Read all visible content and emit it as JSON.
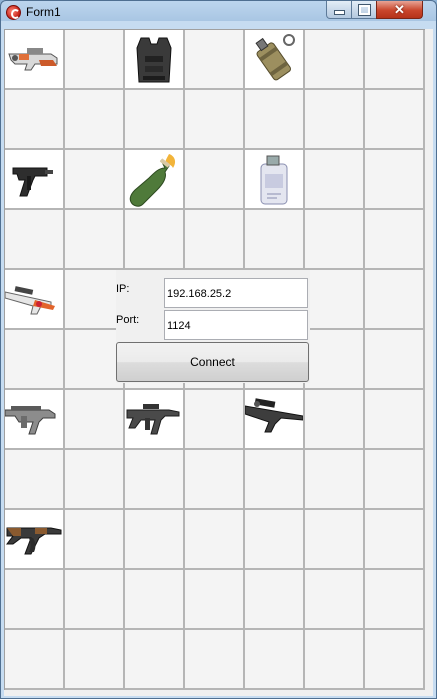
{
  "window": {
    "title": "Form1",
    "icon": "app-logo-icon",
    "controls": [
      "minimize-icon",
      "maximize-icon",
      "close-icon"
    ]
  },
  "grid": {
    "columns": 7,
    "rows": 11,
    "items": [
      {
        "row": 0,
        "col": 0,
        "icon": "p90-smg-icon"
      },
      {
        "row": 0,
        "col": 2,
        "icon": "kevlar-vest-icon"
      },
      {
        "row": 0,
        "col": 4,
        "icon": "flashbang-grenade-icon"
      },
      {
        "row": 2,
        "col": 0,
        "icon": "tec9-pistol-icon"
      },
      {
        "row": 2,
        "col": 2,
        "icon": "molotov-icon"
      },
      {
        "row": 2,
        "col": 4,
        "icon": "smoke-grenade-icon"
      },
      {
        "row": 4,
        "col": 0,
        "icon": "awp-sniper-icon"
      },
      {
        "row": 6,
        "col": 0,
        "icon": "famas-rifle-icon"
      },
      {
        "row": 6,
        "col": 2,
        "icon": "m4a4-rifle-icon"
      },
      {
        "row": 6,
        "col": 4,
        "icon": "scout-sniper-icon"
      },
      {
        "row": 8,
        "col": 0,
        "icon": "ak47-rifle-icon"
      }
    ]
  },
  "connection": {
    "ip_label": "IP:",
    "ip_value": "192.168.25.2",
    "port_label": "Port:",
    "port_value": "1124",
    "connect_label": "Connect"
  }
}
